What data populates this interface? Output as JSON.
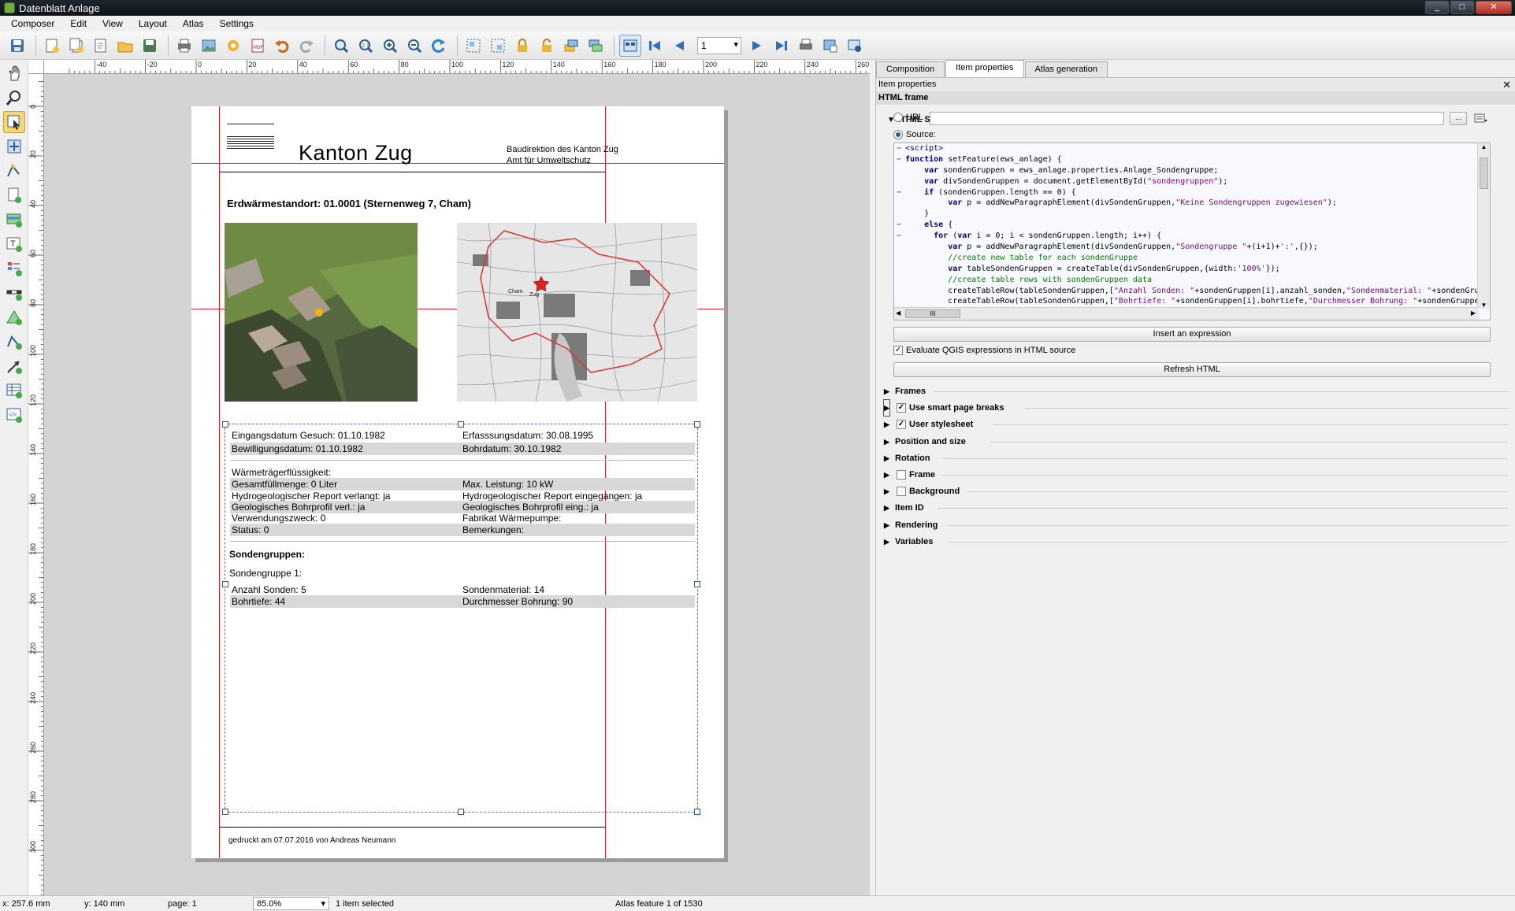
{
  "window": {
    "title": "Datenblatt Anlage",
    "min": "_",
    "max": "□",
    "close": "✕"
  },
  "menu": [
    "Composer",
    "Edit",
    "View",
    "Layout",
    "Atlas",
    "Settings"
  ],
  "toolbar": {
    "page_value": "1"
  },
  "ruler": {
    "h_labels": [
      "-40",
      "-20",
      "0",
      "20",
      "40",
      "60",
      "80",
      "100",
      "120",
      "140",
      "160",
      "180",
      "200",
      "220",
      "240",
      "260"
    ],
    "v_labels": [
      "0",
      "20",
      "40",
      "60",
      "80",
      "100",
      "120",
      "140",
      "160",
      "180",
      "200",
      "220",
      "240",
      "260",
      "280",
      "300"
    ]
  },
  "document": {
    "kanton": "Kanton Zug",
    "amt_line1": "Baudirektion des Kanton Zug",
    "amt_line2": "Amt für Umweltschutz",
    "heading": "Erdwärmestandort: 01.0001 (Sternenweg 7, Cham)",
    "rows1": [
      {
        "c1": "Eingangsdatum Gesuch: 01.10.1982",
        "c2": "Erfasssungsdatum: 30.08.1995",
        "gray": false
      },
      {
        "c1": "Bewilligungsdatum: 01.10.1982",
        "c2": "Bohrdatum: 30.10.1982",
        "gray": true
      }
    ],
    "waerme_label": "Wärmeträgerflüssigkeit:",
    "rows2": [
      {
        "c1": "Gesamtfüllmenge: 0 Liter",
        "c2": "Max. Leistung: 10 kW",
        "gray": true
      },
      {
        "c1": "Hydrogeologischer Report verlangt: ja",
        "c2": "Hydrogeologischer Report eingegangen: ja",
        "gray": false
      },
      {
        "c1": "Geologisches Bohrprofil verl.: ja",
        "c2": "Geologisches Bohrprofil eing.: ja",
        "gray": true
      },
      {
        "c1": "Verwendungszweck: 0",
        "c2": "Fabrikat Wärmepumpe:",
        "gray": false
      },
      {
        "c1": "Status: 0",
        "c2": "Bemerkungen:",
        "gray": true
      }
    ],
    "sondengruppen_title": "Sondengruppen:",
    "sondengruppe1": "Sondengruppe 1:",
    "rows3": [
      {
        "c1": "Anzahl Sonden: 5",
        "c2": "Sondenmaterial: 14",
        "gray": false
      },
      {
        "c1": "Bohrtiefe: 44",
        "c2": "Durchmesser Bohrung: 90",
        "gray": true
      }
    ],
    "footer": "gedruckt am 07.07.2016 von Andreas Neumann",
    "map_labels": {
      "cham": "Cham",
      "zug": "Zug"
    }
  },
  "panel": {
    "tabs": [
      "Composition",
      "Item properties",
      "Atlas generation"
    ],
    "active_tab": 1,
    "header": "Item properties",
    "close": "✕",
    "frame_title": "HTML frame",
    "html_source_title": "HTML Source",
    "url_label": "URL",
    "url_value": "",
    "browse_label": "...",
    "source_label": "Source:",
    "code_lines": [
      "<script>",
      "function setFeature(ews_anlage) {",
      "    var sondenGruppen = ews_anlage.properties.Anlage_Sondengruppe;",
      "    var divSondenGruppen = document.getElementById(\"sondengruppen\");",
      "    if (sondenGruppen.length == 0) {",
      "         var p = addNewParagraphElement(divSondenGruppen,\"Keine Sondengruppen zugewiesen\");",
      "    }",
      "    else {",
      "      for (var i = 0; i < sondenGruppen.length; i++) {",
      "         var p = addNewParagraphElement(divSondenGruppen,\"Sondengruppe \"+(i+1)+':',{});",
      "         //create new table for each sondenGruppe",
      "         var tableSondenGruppen = createTable(divSondenGruppen,{width:'100%'});",
      "         //create table rows with sondenGruppen data",
      "         createTableRow(tableSondenGruppen,[\"Anzahl Sonden: \"+sondenGruppen[i].anzahl_sonden,\"Sondenmaterial: \"+sondenGruppen[",
      "         createTableRow(tableSondenGruppen,[\"Bohrtiefe: \"+sondenGruppen[i].bohrtiefe,\"Durchmesser Bohrung: \"+sondenGruppen[i].d"
    ],
    "scroll_grip": "III",
    "insert_expression": "Insert an expression",
    "evaluate_label": "Evaluate QGIS expressions in HTML source",
    "refresh_label": "Refresh HTML",
    "sections": [
      {
        "label": "Frames",
        "checkbox": false,
        "checked": false
      },
      {
        "label": "Use smart page breaks",
        "checkbox": true,
        "checked": true
      },
      {
        "label": "User stylesheet",
        "checkbox": true,
        "checked": true
      },
      {
        "label": "Position and size",
        "checkbox": false,
        "checked": false
      },
      {
        "label": "Rotation",
        "checkbox": false,
        "checked": false
      },
      {
        "label": "Frame",
        "checkbox": true,
        "checked": false
      },
      {
        "label": "Background",
        "checkbox": true,
        "checked": false
      },
      {
        "label": "Item ID",
        "checkbox": false,
        "checked": false
      },
      {
        "label": "Rendering",
        "checkbox": false,
        "checked": false
      },
      {
        "label": "Variables",
        "checkbox": false,
        "checked": false
      }
    ]
  },
  "status": {
    "x": "x: 257.6 mm",
    "y": "y: 140 mm",
    "page": "page: 1",
    "zoom": "85.0%",
    "selected": "1 item selected",
    "atlas": "Atlas feature 1 of 1530"
  },
  "colors": {
    "accent_red": "#e0202a",
    "frame_handle": "#2d58a8"
  }
}
